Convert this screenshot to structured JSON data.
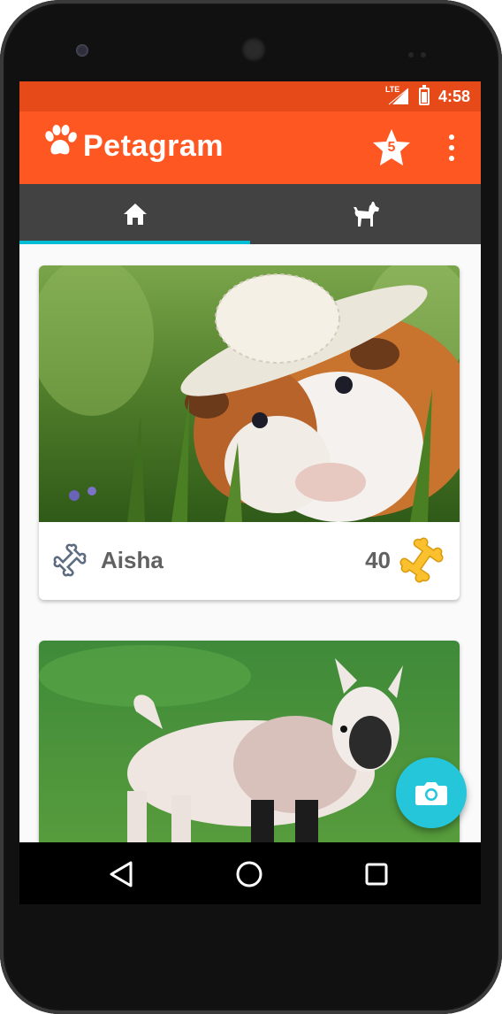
{
  "status_bar": {
    "time": "4:58",
    "network": "LTE",
    "icons": [
      "lte-signal-icon",
      "battery-icon"
    ]
  },
  "app_bar": {
    "title": "Petagram",
    "icons": [
      "paw-icon",
      "star-icon",
      "overflow-menu-icon"
    ],
    "star_badge": "5"
  },
  "tabs": [
    {
      "icon": "home-icon",
      "selected": true
    },
    {
      "icon": "dog-icon",
      "selected": false
    }
  ],
  "cards": [
    {
      "name": "Aisha",
      "likes": "40",
      "photo": "guinea-pig-with-hat"
    },
    {
      "name": "",
      "likes": "",
      "photo": "baby-goat"
    }
  ],
  "fab": {
    "icon": "camera-icon"
  },
  "nav_bar": {
    "icons": [
      "back-icon",
      "home-circle-icon",
      "recents-icon"
    ]
  },
  "colors": {
    "status_bar": "#e64a19",
    "app_bar": "#ff5722",
    "tab_bar": "#424242",
    "tab_indicator": "#00bcd4",
    "fab": "#26c6da",
    "bone_gold": "#fbc02d"
  }
}
